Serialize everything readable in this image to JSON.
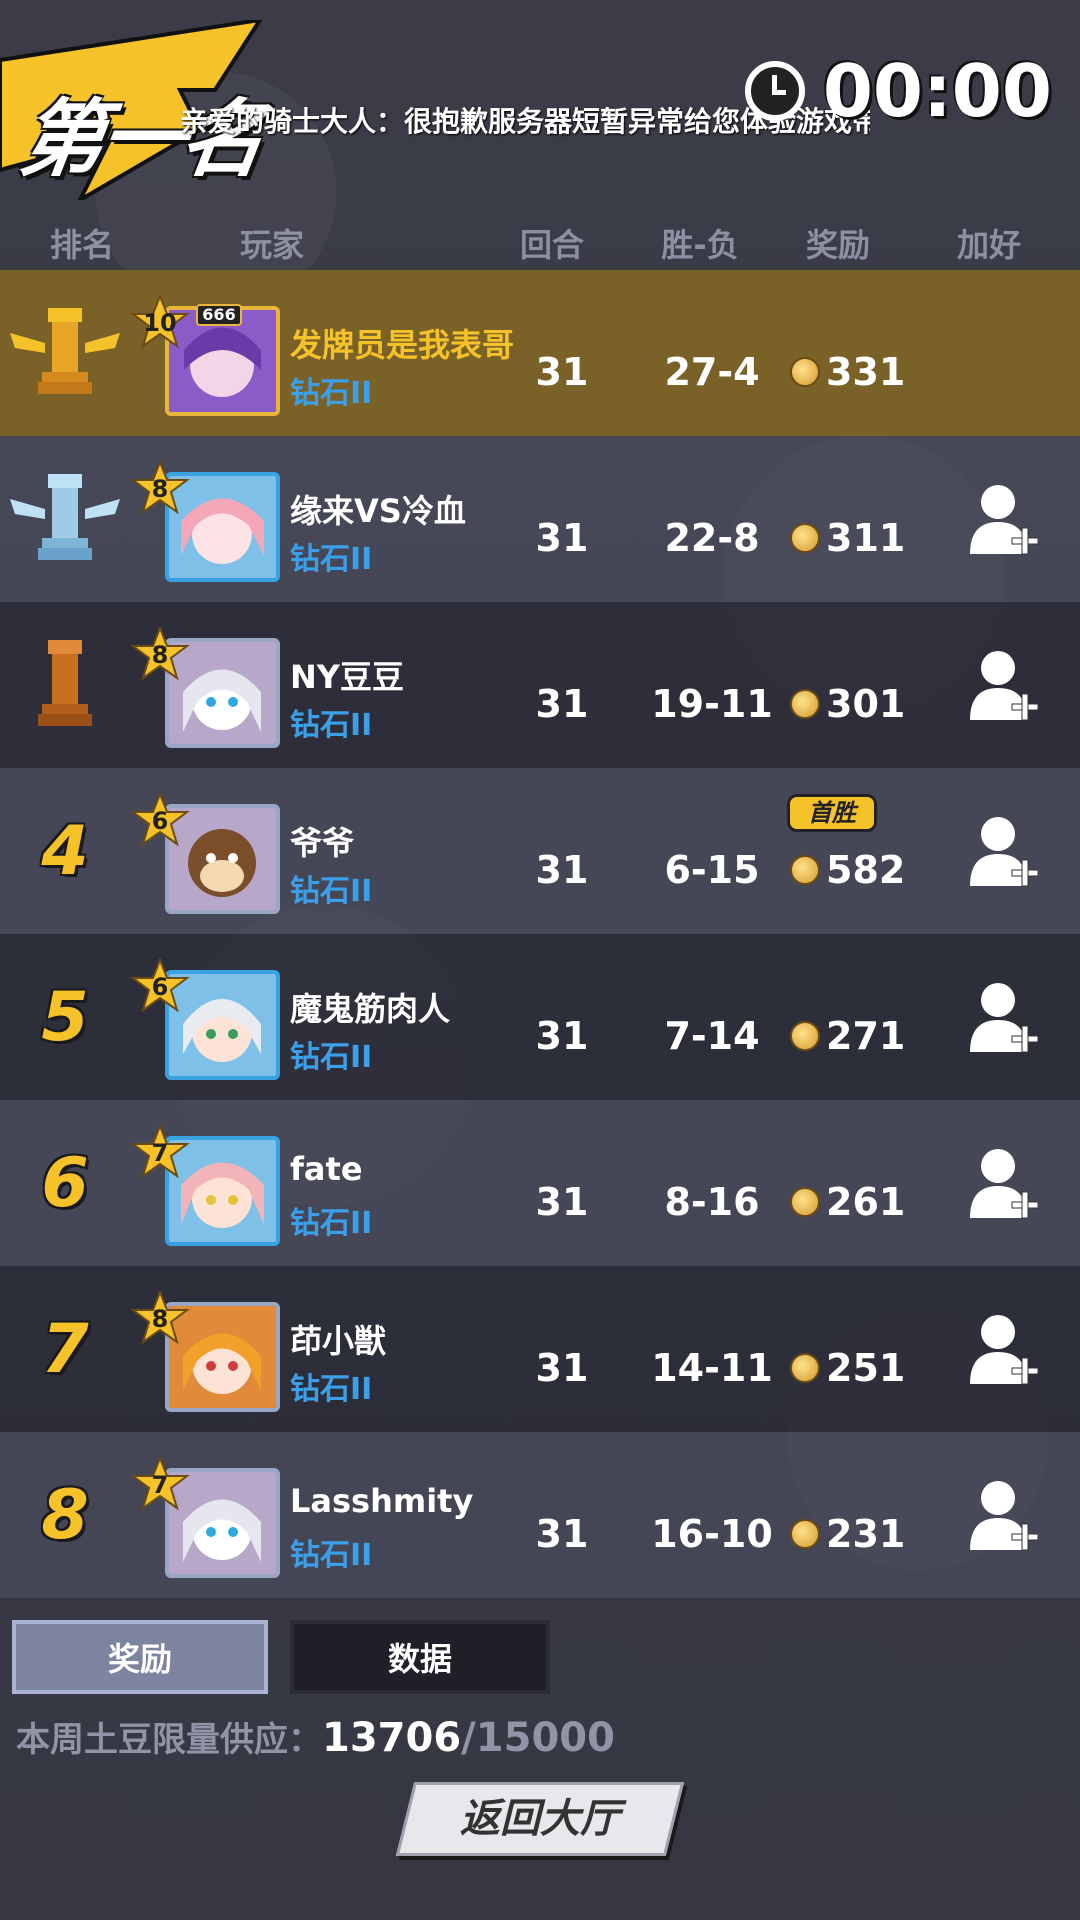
{
  "header": {
    "rank_title": "第一名",
    "marquee": "亲爱的骑士大人：很抱歉服务器短暂异常给您体验游戏带",
    "timer": "00:00",
    "clock_icon": "clock-icon"
  },
  "columns": {
    "rank": "排名",
    "player": "玩家",
    "rounds": "回合",
    "winloss": "胜-负",
    "reward": "奖励",
    "add_friend": "加好友"
  },
  "rows": [
    {
      "rank": "1",
      "rank_icon": "gold-rook-trophy-icon",
      "level": "10",
      "badge": "666",
      "name": "发牌员是我表哥",
      "tier": "钻石II",
      "rounds": "31",
      "winloss": "27-4",
      "reward": "331",
      "me": true
    },
    {
      "rank": "2",
      "rank_icon": "silver-rook-trophy-icon",
      "level": "8",
      "name": "缘来VS冷血",
      "tier": "钻石II",
      "rounds": "31",
      "winloss": "22-8",
      "reward": "311"
    },
    {
      "rank": "3",
      "rank_icon": "bronze-rook-trophy-icon",
      "level": "8",
      "name": "NY豆豆",
      "tier": "钻石II",
      "rounds": "31",
      "winloss": "19-11",
      "reward": "301"
    },
    {
      "rank": "4",
      "level": "6",
      "name": "爷爷",
      "tier": "钻石II",
      "rounds": "31",
      "winloss": "6-15",
      "reward": "582",
      "first_win": "首胜"
    },
    {
      "rank": "5",
      "level": "6",
      "name": "魔鬼筋肉人",
      "tier": "钻石II",
      "rounds": "31",
      "winloss": "7-14",
      "reward": "271"
    },
    {
      "rank": "6",
      "level": "7",
      "name": "fate",
      "tier": "钻石II",
      "rounds": "31",
      "winloss": "8-16",
      "reward": "261"
    },
    {
      "rank": "7",
      "level": "8",
      "name": "茚小獣",
      "tier": "钻石II",
      "rounds": "31",
      "winloss": "14-11",
      "reward": "251"
    },
    {
      "rank": "8",
      "level": "7",
      "name": "Lasshmity",
      "tier": "钻石II",
      "rounds": "31",
      "winloss": "16-10",
      "reward": "231"
    }
  ],
  "tabs": {
    "reward": "奖励",
    "data": "数据"
  },
  "supply": {
    "label": "本周土豆限量供应：",
    "current": "13706",
    "max": "/15000"
  },
  "return_button": "返回大厅",
  "colors": {
    "accent_gold": "#f6c229",
    "tier_blue": "#3aa0ea",
    "highlight_row": "#7a6128"
  }
}
